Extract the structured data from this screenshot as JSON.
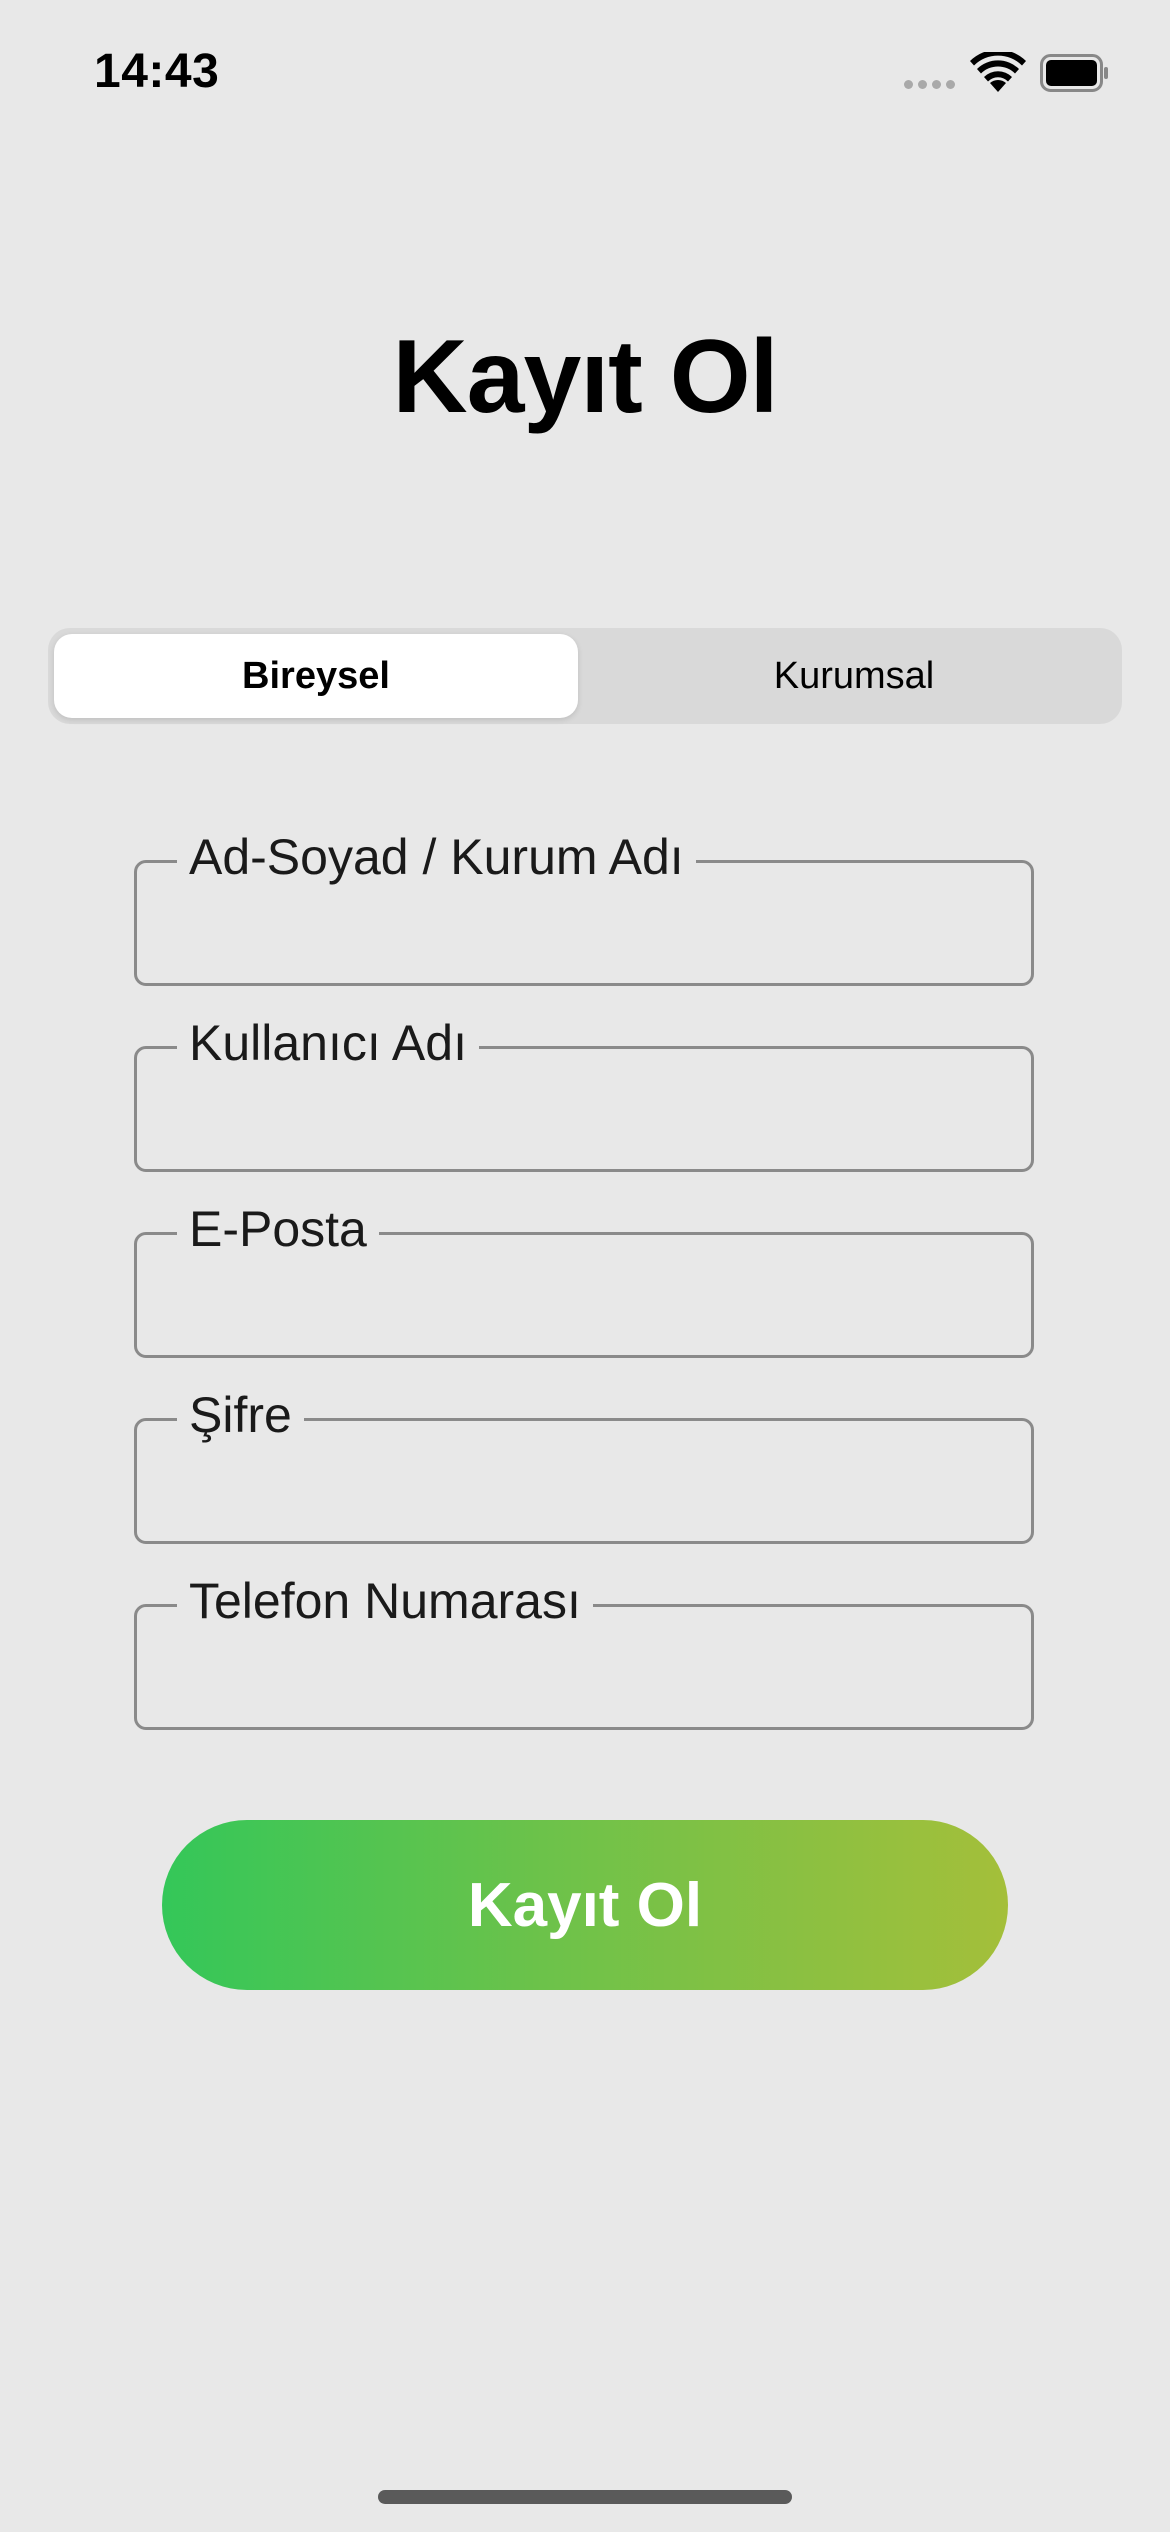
{
  "status_bar": {
    "time": "14:43",
    "signal_icon": "cellular-signal-icon",
    "wifi_icon": "wifi-icon",
    "battery_icon": "battery-icon"
  },
  "title": "Kayıt Ol",
  "segmented_control": {
    "options": [
      "Bireysel",
      "Kurumsal"
    ],
    "selected": "Bireysel"
  },
  "form": {
    "fields": [
      {
        "label": "Ad-Soyad / Kurum Adı",
        "value": ""
      },
      {
        "label": "Kullanıcı Adı",
        "value": ""
      },
      {
        "label": "E-Posta",
        "value": ""
      },
      {
        "label": "Şifre",
        "value": ""
      },
      {
        "label": "Telefon Numarası",
        "value": ""
      }
    ]
  },
  "submit_button": {
    "label": "Kayıt Ol"
  },
  "colors": {
    "background": "#e8e8e8",
    "gradient_start": "#34c759",
    "gradient_end": "#a4bf3a",
    "field_border": "#8a8a8a"
  }
}
